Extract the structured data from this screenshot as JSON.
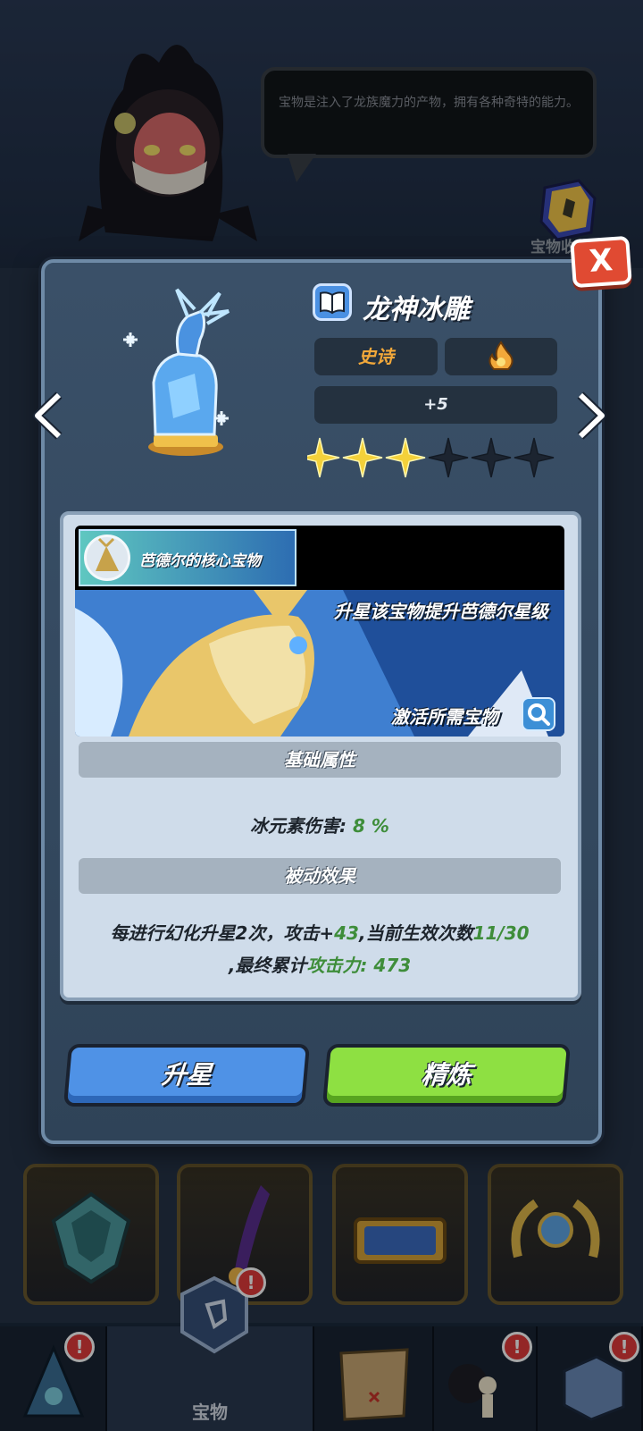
{
  "npc": {
    "speech": "宝物是注入了龙族魔力的产物，拥有各种奇特的能力。"
  },
  "header": {
    "collection_label": "宝物收集"
  },
  "modal": {
    "close_label": "X",
    "title": "龙神冰雕",
    "rarity": "史诗",
    "level": "+5",
    "stars": {
      "filled": 3,
      "total": 6
    },
    "core_tag": "芭德尔的核心宝物",
    "banner_line1": "升星该宝物提升芭德尔星级",
    "banner_line2": "激活所需宝物",
    "base_attr_title": "基础属性",
    "base_attr": {
      "label": "冰元素伤害: ",
      "value": "8 %"
    },
    "passive_title": "被动效果",
    "passive": {
      "prefix": "每进行幻化升星2次，攻击+",
      "atk_gain": "43",
      "mid": ",当前生效次数",
      "count": "11/30",
      "prefix2": ",最终累计",
      "total_label": "攻击力: 473"
    },
    "btn_upgrade": "升星",
    "btn_refine": "精炼"
  },
  "navbar": {
    "tabs": [
      {
        "label": "",
        "icon": "ice-crystal-icon",
        "badge": "!"
      },
      {
        "label": "宝物",
        "icon": "treasure-icon",
        "badge": "!"
      },
      {
        "label": "",
        "icon": "map-icon",
        "badge": ""
      },
      {
        "label": "",
        "icon": "character-icon",
        "badge": "!"
      },
      {
        "label": "",
        "icon": "cube-icon",
        "badge": "!"
      }
    ]
  },
  "colors": {
    "accent_blue": "#4f92e6",
    "accent_green": "#8ee042",
    "epic_orange": "#f2a83a",
    "stat_green": "#3e8d3a"
  }
}
